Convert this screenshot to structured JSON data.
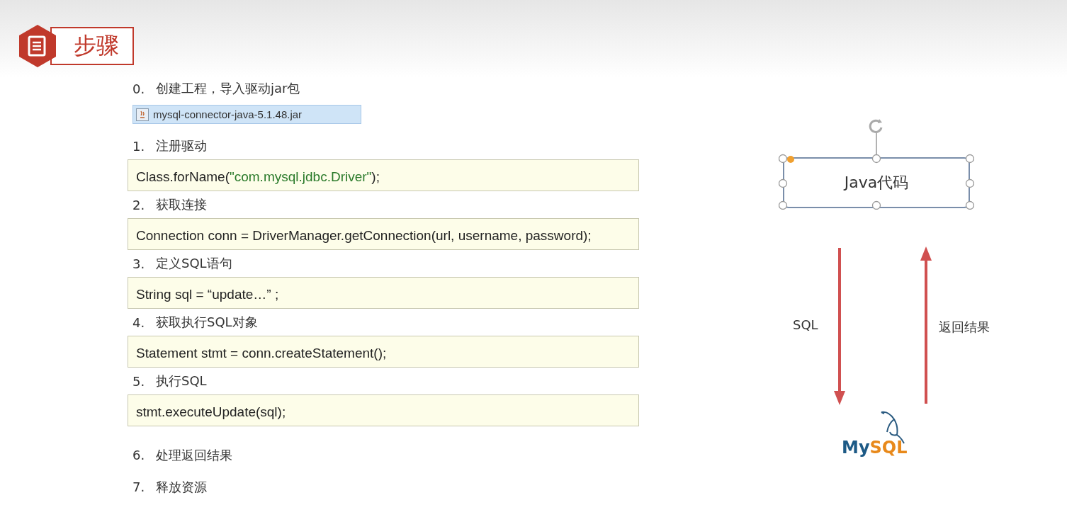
{
  "header": {
    "title": "步骤"
  },
  "steps": [
    {
      "number": "0.",
      "label": "创建工程，导入驱动jar包",
      "kind": "jar",
      "file": "mysql-connector-java-5.1.48.jar"
    },
    {
      "number": "1.",
      "label": "注册驱动",
      "kind": "code",
      "code": [
        {
          "kind": "plain",
          "text": "Class.forName("
        },
        {
          "kind": "string",
          "text": "\"com.mysql.jdbc.Driver\""
        },
        {
          "kind": "plain",
          "text": ");"
        }
      ]
    },
    {
      "number": "2.",
      "label": "获取连接",
      "kind": "code",
      "code": [
        {
          "kind": "plain",
          "text": "Connection conn = DriverManager.getConnection(url, username, password);"
        }
      ]
    },
    {
      "number": "3.",
      "label": "定义SQL语句",
      "kind": "code",
      "code": [
        {
          "kind": "plain",
          "text": "String sql = “update…” ;"
        }
      ]
    },
    {
      "number": "4.",
      "label": "获取执行SQL对象",
      "kind": "code",
      "code": [
        {
          "kind": "plain",
          "text": "Statement stmt = conn.createStatement();"
        }
      ]
    },
    {
      "number": "5.",
      "label": "执行SQL",
      "kind": "code",
      "code": [
        {
          "kind": "plain",
          "text": "stmt.executeUpdate(sql);"
        }
      ]
    },
    {
      "number": "6.",
      "label": "处理返回结果",
      "kind": "text"
    },
    {
      "number": "7.",
      "label": "释放资源",
      "kind": "text"
    }
  ],
  "diagram": {
    "node": {
      "label": "Java代码",
      "selected": true
    },
    "down_label": "SQL",
    "up_label": "返回结果",
    "logo": {
      "main": "My",
      "accent": "SQL"
    }
  }
}
